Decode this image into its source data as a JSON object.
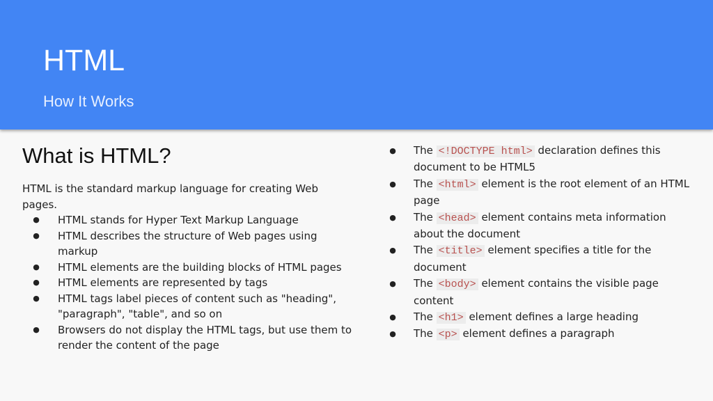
{
  "banner": {
    "title": "HTML",
    "subtitle": "How It Works"
  },
  "left": {
    "heading": "What is HTML?",
    "intro": "HTML is the standard markup language for creating Web pages.",
    "bullets": [
      "HTML stands for Hyper Text Markup Language",
      "HTML describes the structure of Web pages using markup",
      "HTML elements are the building blocks of HTML pages",
      "HTML elements are represented by tags",
      "HTML tags label pieces of content such as \"heading\", \"paragraph\", \"table\", and so on",
      "Browsers do not display the HTML tags, but use them to render the content of the page"
    ]
  },
  "right": {
    "bullets": [
      {
        "pre": "The ",
        "code": "<!DOCTYPE html>",
        "post": " declaration defines this document to be HTML5"
      },
      {
        "pre": "The ",
        "code": "<html>",
        "post": " element is the root element of an HTML page"
      },
      {
        "pre": "The ",
        "code": "<head>",
        "post": " element contains meta information about the document"
      },
      {
        "pre": "The ",
        "code": "<title>",
        "post": " element specifies a title for the document"
      },
      {
        "pre": "The ",
        "code": "<body>",
        "post": " element contains the visible page content"
      },
      {
        "pre": "The ",
        "code": "<h1>",
        "post": " element defines a large heading"
      },
      {
        "pre": "The ",
        "code": "<p>",
        "post": " element defines a paragraph"
      }
    ]
  },
  "bullet_glyph": "●",
  "colors": {
    "banner": "#4285f4",
    "background": "#f8f8f8",
    "code_text": "#b8514f",
    "code_background": "#ececec"
  }
}
